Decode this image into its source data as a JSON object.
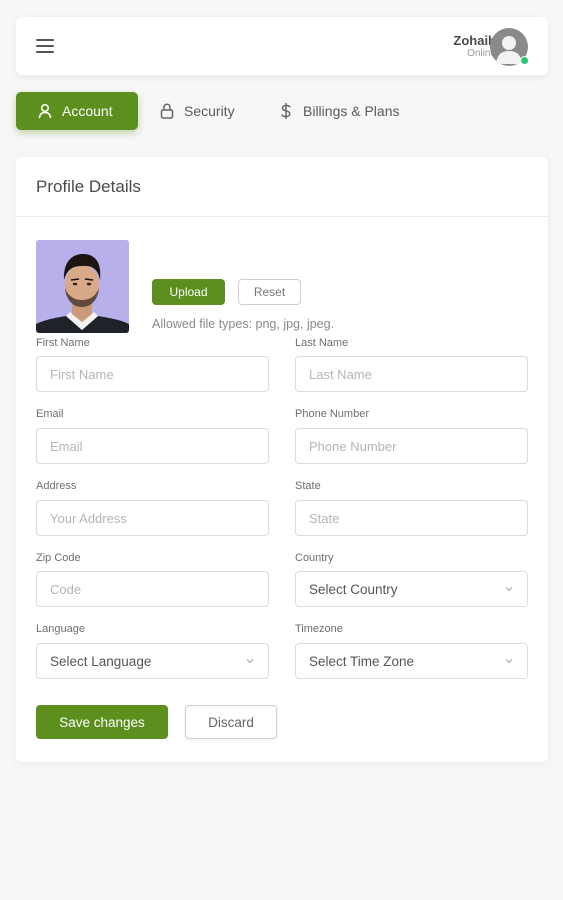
{
  "header": {
    "user_name": "Zohaib",
    "user_status": "Online",
    "avatar_icon": "user-avatar-icon",
    "menu_icon": "hamburger-menu-icon"
  },
  "tabs": [
    {
      "label": "Account",
      "icon": "user-icon",
      "active": true
    },
    {
      "label": "Security",
      "icon": "lock-icon",
      "active": false
    },
    {
      "label": "Billings & Plans",
      "icon": "dollar-icon",
      "active": false
    }
  ],
  "profile": {
    "title": "Profile Details",
    "upload_label": "Upload",
    "reset_label": "Reset",
    "file_hint": "Allowed file types: png, jpg, jpeg."
  },
  "form": {
    "first_name": {
      "label": "First Name",
      "placeholder": "First Name",
      "value": ""
    },
    "last_name": {
      "label": "Last Name",
      "placeholder": "Last Name",
      "value": ""
    },
    "email": {
      "label": "Email",
      "placeholder": "Email",
      "value": ""
    },
    "phone": {
      "label": "Phone Number",
      "placeholder": "Phone Number",
      "value": ""
    },
    "address": {
      "label": "Address",
      "placeholder": "Your Address",
      "value": ""
    },
    "state": {
      "label": "State",
      "placeholder": "State",
      "value": ""
    },
    "zip": {
      "label": "Zip Code",
      "placeholder": "Code",
      "value": ""
    },
    "country": {
      "label": "Country",
      "selected": "Select Country"
    },
    "language": {
      "label": "Language",
      "selected": "Select Language"
    },
    "timezone": {
      "label": "Timezone",
      "selected": "Select Time Zone"
    }
  },
  "actions": {
    "save_label": "Save changes",
    "discard_label": "Discard"
  },
  "colors": {
    "accent": "#5d8f1f",
    "online": "#28c76f",
    "background": "#f7f7f7"
  }
}
